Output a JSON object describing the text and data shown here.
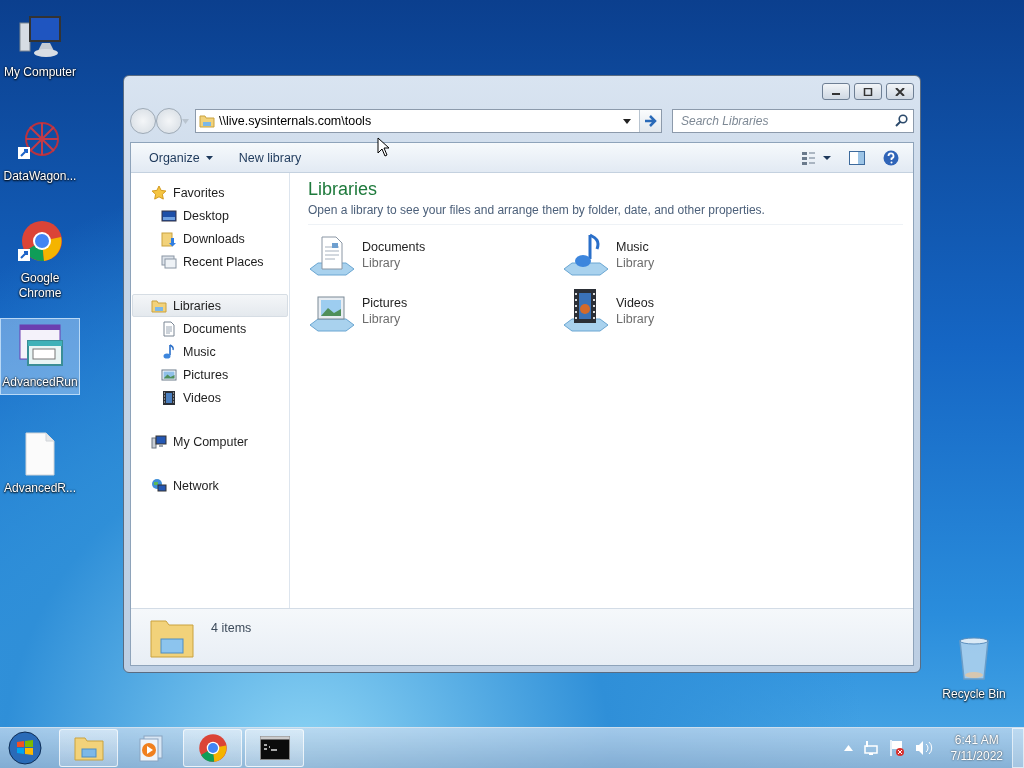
{
  "desktop_icons": [
    {
      "label": "My Computer",
      "kind": "computer",
      "selected": false
    },
    {
      "label": "DataWagon...",
      "kind": "network-shortcut",
      "selected": false
    },
    {
      "label": "Google Chrome",
      "kind": "chrome",
      "selected": false
    },
    {
      "label": "AdvancedRun",
      "kind": "app-windows",
      "selected": true
    },
    {
      "label": "AdvancedR...",
      "kind": "file",
      "selected": false
    },
    {
      "label": "Recycle Bin",
      "kind": "recycle",
      "selected": false
    }
  ],
  "window": {
    "address": "\\\\live.sysinternals.com\\tools",
    "search": {
      "placeholder": "Search Libraries"
    },
    "toolbar": [
      {
        "label": "Organize",
        "dropdown": true
      },
      {
        "label": "New library",
        "dropdown": false
      }
    ],
    "nav": [
      {
        "label": "Favorites",
        "kind": "star",
        "selected": false,
        "children": [
          {
            "label": "Desktop",
            "kind": "desktop",
            "selected": false
          },
          {
            "label": "Downloads",
            "kind": "downloads",
            "selected": false
          },
          {
            "label": "Recent Places",
            "kind": "recent",
            "selected": false
          }
        ]
      },
      {
        "label": "Libraries",
        "kind": "libraries",
        "selected": true,
        "children": [
          {
            "label": "Documents",
            "kind": "documents",
            "selected": false
          },
          {
            "label": "Music",
            "kind": "music",
            "selected": false
          },
          {
            "label": "Pictures",
            "kind": "pictures",
            "selected": false
          },
          {
            "label": "Videos",
            "kind": "videos",
            "selected": false
          }
        ]
      },
      {
        "label": "My Computer",
        "kind": "computer",
        "selected": false
      },
      {
        "label": "Network",
        "kind": "network",
        "selected": false
      }
    ],
    "content": {
      "title": "Libraries",
      "description": "Open a library to see your files and arrange them by folder, date, and other properties.",
      "items": [
        {
          "name": "Documents",
          "type": "Library",
          "kind": "documents"
        },
        {
          "name": "Music",
          "type": "Library",
          "kind": "music"
        },
        {
          "name": "Pictures",
          "type": "Library",
          "kind": "pictures"
        },
        {
          "name": "Videos",
          "type": "Library",
          "kind": "videos"
        }
      ]
    },
    "details": {
      "count": "4 items"
    }
  },
  "taskbar": {
    "items": [
      {
        "kind": "explorer",
        "running": true
      },
      {
        "kind": "media",
        "running": false
      },
      {
        "kind": "chrome",
        "running": true
      },
      {
        "kind": "terminal",
        "running": true
      }
    ],
    "clock": {
      "time": "6:41 AM",
      "date": "7/11/2022"
    }
  }
}
